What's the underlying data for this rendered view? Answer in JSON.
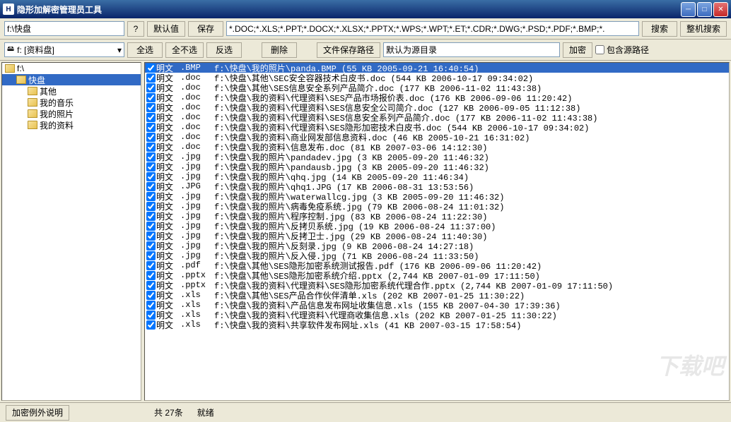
{
  "window": {
    "title": "隐形加解密管理员工具"
  },
  "toolbar1": {
    "path": "f:\\快盘",
    "help": "?",
    "default": "默认值",
    "save": "保存",
    "filter": "*.DOC;*.XLS;*.PPT;*.DOCX;*.XLSX;*.PPTX;*.WPS;*.WPT;*.ET;*.CDR;*.DWG;*.PSD;*.PDF;*.BMP;*.",
    "search": "搜索",
    "fullsearch": "整机搜索"
  },
  "toolbar2": {
    "drive": "f: [资料盘]",
    "selectall": "全选",
    "selectnone": "全不选",
    "invert": "反选",
    "delete": "删除",
    "savepath_btn": "文件保存路径",
    "savepath_val": "默认为源目录",
    "encrypt": "加密",
    "include_src": "包含源路径"
  },
  "tree": [
    {
      "label": "f:\\",
      "indent": 0,
      "open": true
    },
    {
      "label": "快盘",
      "indent": 1,
      "open": true,
      "sel": true
    },
    {
      "label": "其他",
      "indent": 2
    },
    {
      "label": "我的音乐",
      "indent": 2
    },
    {
      "label": "我的照片",
      "indent": 2
    },
    {
      "label": "我的资料",
      "indent": 2
    }
  ],
  "list": [
    {
      "type": "明文",
      "ext": ".BMP",
      "path": "f:\\快盘\\我的照片\\panda.BMP (55 KB 2005-09-21 16:40:54)",
      "sel": true
    },
    {
      "type": "明文",
      "ext": ".doc",
      "path": "f:\\快盘\\其他\\SEC安全容器技术白皮书.doc (544 KB 2006-10-17 09:34:02)"
    },
    {
      "type": "明文",
      "ext": ".doc",
      "path": "f:\\快盘\\其他\\SES信息安全系列产品简介.doc (177 KB 2006-11-02 11:43:38)"
    },
    {
      "type": "明文",
      "ext": ".doc",
      "path": "f:\\快盘\\我的资料\\代理资料\\SES产品市场报价表.doc (176 KB 2006-09-06 11:20:42)"
    },
    {
      "type": "明文",
      "ext": ".doc",
      "path": "f:\\快盘\\我的资料\\代理资料\\SES信息安全公司简介.doc (127 KB 2006-09-05 11:12:38)"
    },
    {
      "type": "明文",
      "ext": ".doc",
      "path": "f:\\快盘\\我的资料\\代理资料\\SES信息安全系列产品简介.doc (177 KB 2006-11-02 11:43:38)"
    },
    {
      "type": "明文",
      "ext": ".doc",
      "path": "f:\\快盘\\我的资料\\代理资料\\SES隐形加密技术白皮书.doc (544 KB 2006-10-17 09:34:02)"
    },
    {
      "type": "明文",
      "ext": ".doc",
      "path": "f:\\快盘\\我的资料\\商业网发部信息资料.doc (46 KB 2005-10-21 16:31:02)"
    },
    {
      "type": "明文",
      "ext": ".doc",
      "path": "f:\\快盘\\我的资料\\信息发布.doc (81 KB 2007-03-06 14:12:30)"
    },
    {
      "type": "明文",
      "ext": ".jpg",
      "path": "f:\\快盘\\我的照片\\pandadev.jpg (3 KB 2005-09-20 11:46:32)"
    },
    {
      "type": "明文",
      "ext": ".jpg",
      "path": "f:\\快盘\\我的照片\\pandausb.jpg (3 KB 2005-09-20 11:46:32)"
    },
    {
      "type": "明文",
      "ext": ".jpg",
      "path": "f:\\快盘\\我的照片\\qhq.jpg (14 KB 2005-09-20 11:46:34)"
    },
    {
      "type": "明文",
      "ext": ".JPG",
      "path": "f:\\快盘\\我的照片\\qhq1.JPG (17 KB 2006-08-31 13:53:56)"
    },
    {
      "type": "明文",
      "ext": ".jpg",
      "path": "f:\\快盘\\我的照片\\waterwallcg.jpg (3 KB 2005-09-20 11:46:32)"
    },
    {
      "type": "明文",
      "ext": ".jpg",
      "path": "f:\\快盘\\我的照片\\病毒免疫系统.jpg (79 KB 2006-08-24 11:01:32)"
    },
    {
      "type": "明文",
      "ext": ".jpg",
      "path": "f:\\快盘\\我的照片\\程序控制.jpg (83 KB 2006-08-24 11:22:30)"
    },
    {
      "type": "明文",
      "ext": ".jpg",
      "path": "f:\\快盘\\我的照片\\反拷贝系统.jpg (19 KB 2006-08-24 11:37:00)"
    },
    {
      "type": "明文",
      "ext": ".jpg",
      "path": "f:\\快盘\\我的照片\\反拷卫士.jpg (29 KB 2006-08-24 11:40:30)"
    },
    {
      "type": "明文",
      "ext": ".jpg",
      "path": "f:\\快盘\\我的照片\\反刻录.jpg (9 KB 2006-08-24 14:27:18)"
    },
    {
      "type": "明文",
      "ext": ".jpg",
      "path": "f:\\快盘\\我的照片\\反入侵.jpg (71 KB 2006-08-24 11:33:50)"
    },
    {
      "type": "明文",
      "ext": ".pdf",
      "path": "f:\\快盘\\其他\\SES隐形加密系统测试报告.pdf (176 KB 2006-09-06 11:20:42)"
    },
    {
      "type": "明文",
      "ext": ".pptx",
      "path": "f:\\快盘\\其他\\SES隐形加密系统介绍.pptx (2,744 KB 2007-01-09 17:11:50)"
    },
    {
      "type": "明文",
      "ext": ".pptx",
      "path": "f:\\快盘\\我的资料\\代理资料\\SES隐形加密系统代理合作.pptx (2,744 KB 2007-01-09 17:11:50)"
    },
    {
      "type": "明文",
      "ext": ".xls",
      "path": "f:\\快盘\\其他\\SES产品合作伙伴清单.xls (202 KB 2007-01-25 11:30:22)"
    },
    {
      "type": "明文",
      "ext": ".xls",
      "path": "f:\\快盘\\我的资料\\产品信息发布网址收集信息.xls (155 KB 2007-04-30 17:39:36)"
    },
    {
      "type": "明文",
      "ext": ".xls",
      "path": "f:\\快盘\\我的资料\\代理资料\\代理商收集信息.xls (202 KB 2007-01-25 11:30:22)"
    },
    {
      "type": "明文",
      "ext": ".xls",
      "path": "f:\\快盘\\我的资料\\共享软件发布网址.xls (41 KB 2007-03-15 17:58:54)"
    }
  ],
  "status": {
    "exception_btn": "加密例外说明",
    "count_prefix": "共 ",
    "count": "27",
    "count_suffix": "条",
    "ready": "就绪"
  },
  "watermark": "下载吧"
}
